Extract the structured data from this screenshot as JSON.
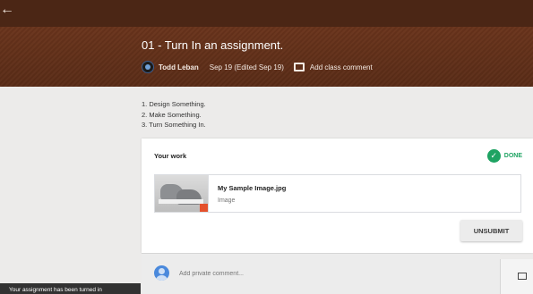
{
  "header": {
    "back_icon": "arrow-left-icon",
    "title": "01 - Turn In an assignment.",
    "author": "Todd Leban",
    "date": "Sep 19 (Edited Sep 19)",
    "add_comment": "Add class comment"
  },
  "instructions": [
    "1. Design Something.",
    "2. Make Something.",
    "3. Turn Something In."
  ],
  "work": {
    "heading": "Your work",
    "status": "DONE",
    "status_color": "#1ea362",
    "attachment": {
      "name": "My Sample Image.jpg",
      "type": "Image"
    },
    "unsubmit_label": "UNSUBMIT"
  },
  "private_comment": {
    "placeholder": "Add private comment..."
  },
  "toast": {
    "message": "Your assignment has been turned in"
  },
  "colors": {
    "topbar": "#4b2615",
    "header": "#6a341c",
    "accent": "#1ea362"
  }
}
